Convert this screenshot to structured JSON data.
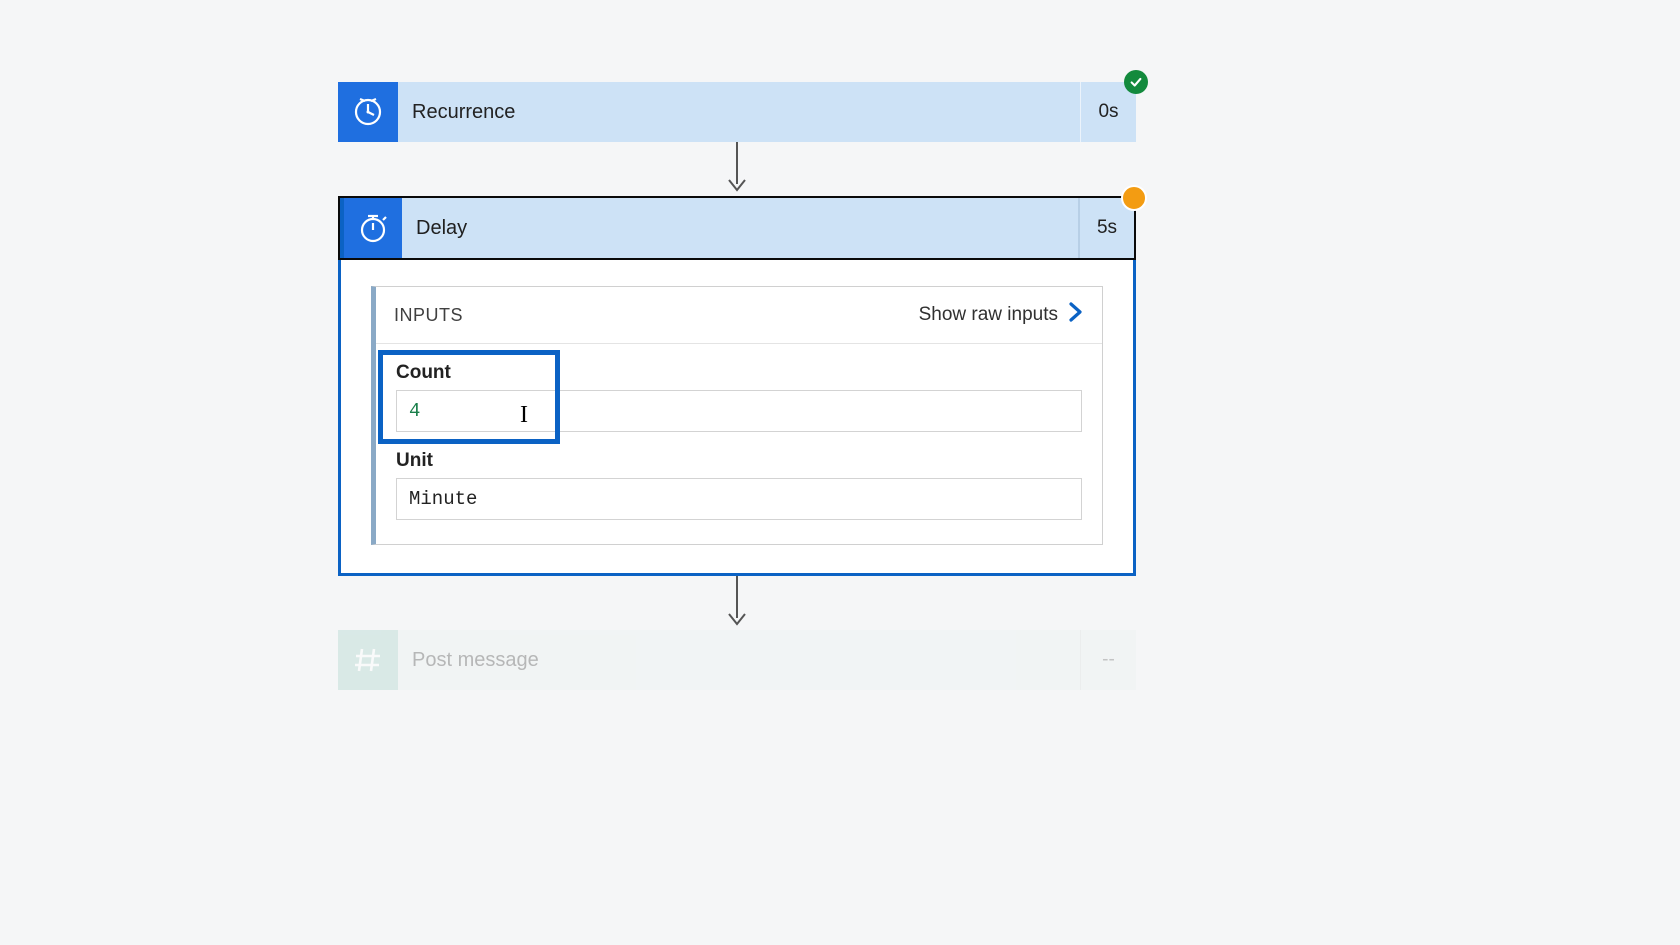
{
  "steps": {
    "recurrence": {
      "title": "Recurrence",
      "duration": "0s",
      "status": "success"
    },
    "delay": {
      "title": "Delay",
      "duration": "5s",
      "status": "running",
      "inputs_panel": {
        "header": "INPUTS",
        "show_raw_label": "Show raw inputs",
        "fields": {
          "count": {
            "label": "Count",
            "value": "4"
          },
          "unit": {
            "label": "Unit",
            "value": "Minute"
          }
        }
      }
    },
    "post_message": {
      "title": "Post message",
      "duration": "--",
      "status": "pending"
    }
  },
  "colors": {
    "brand_blue": "#1f6fe0",
    "accent_blue": "#0b62c4",
    "header_fill": "#cde2f6",
    "success": "#138a3d",
    "running": "#f39c12"
  }
}
